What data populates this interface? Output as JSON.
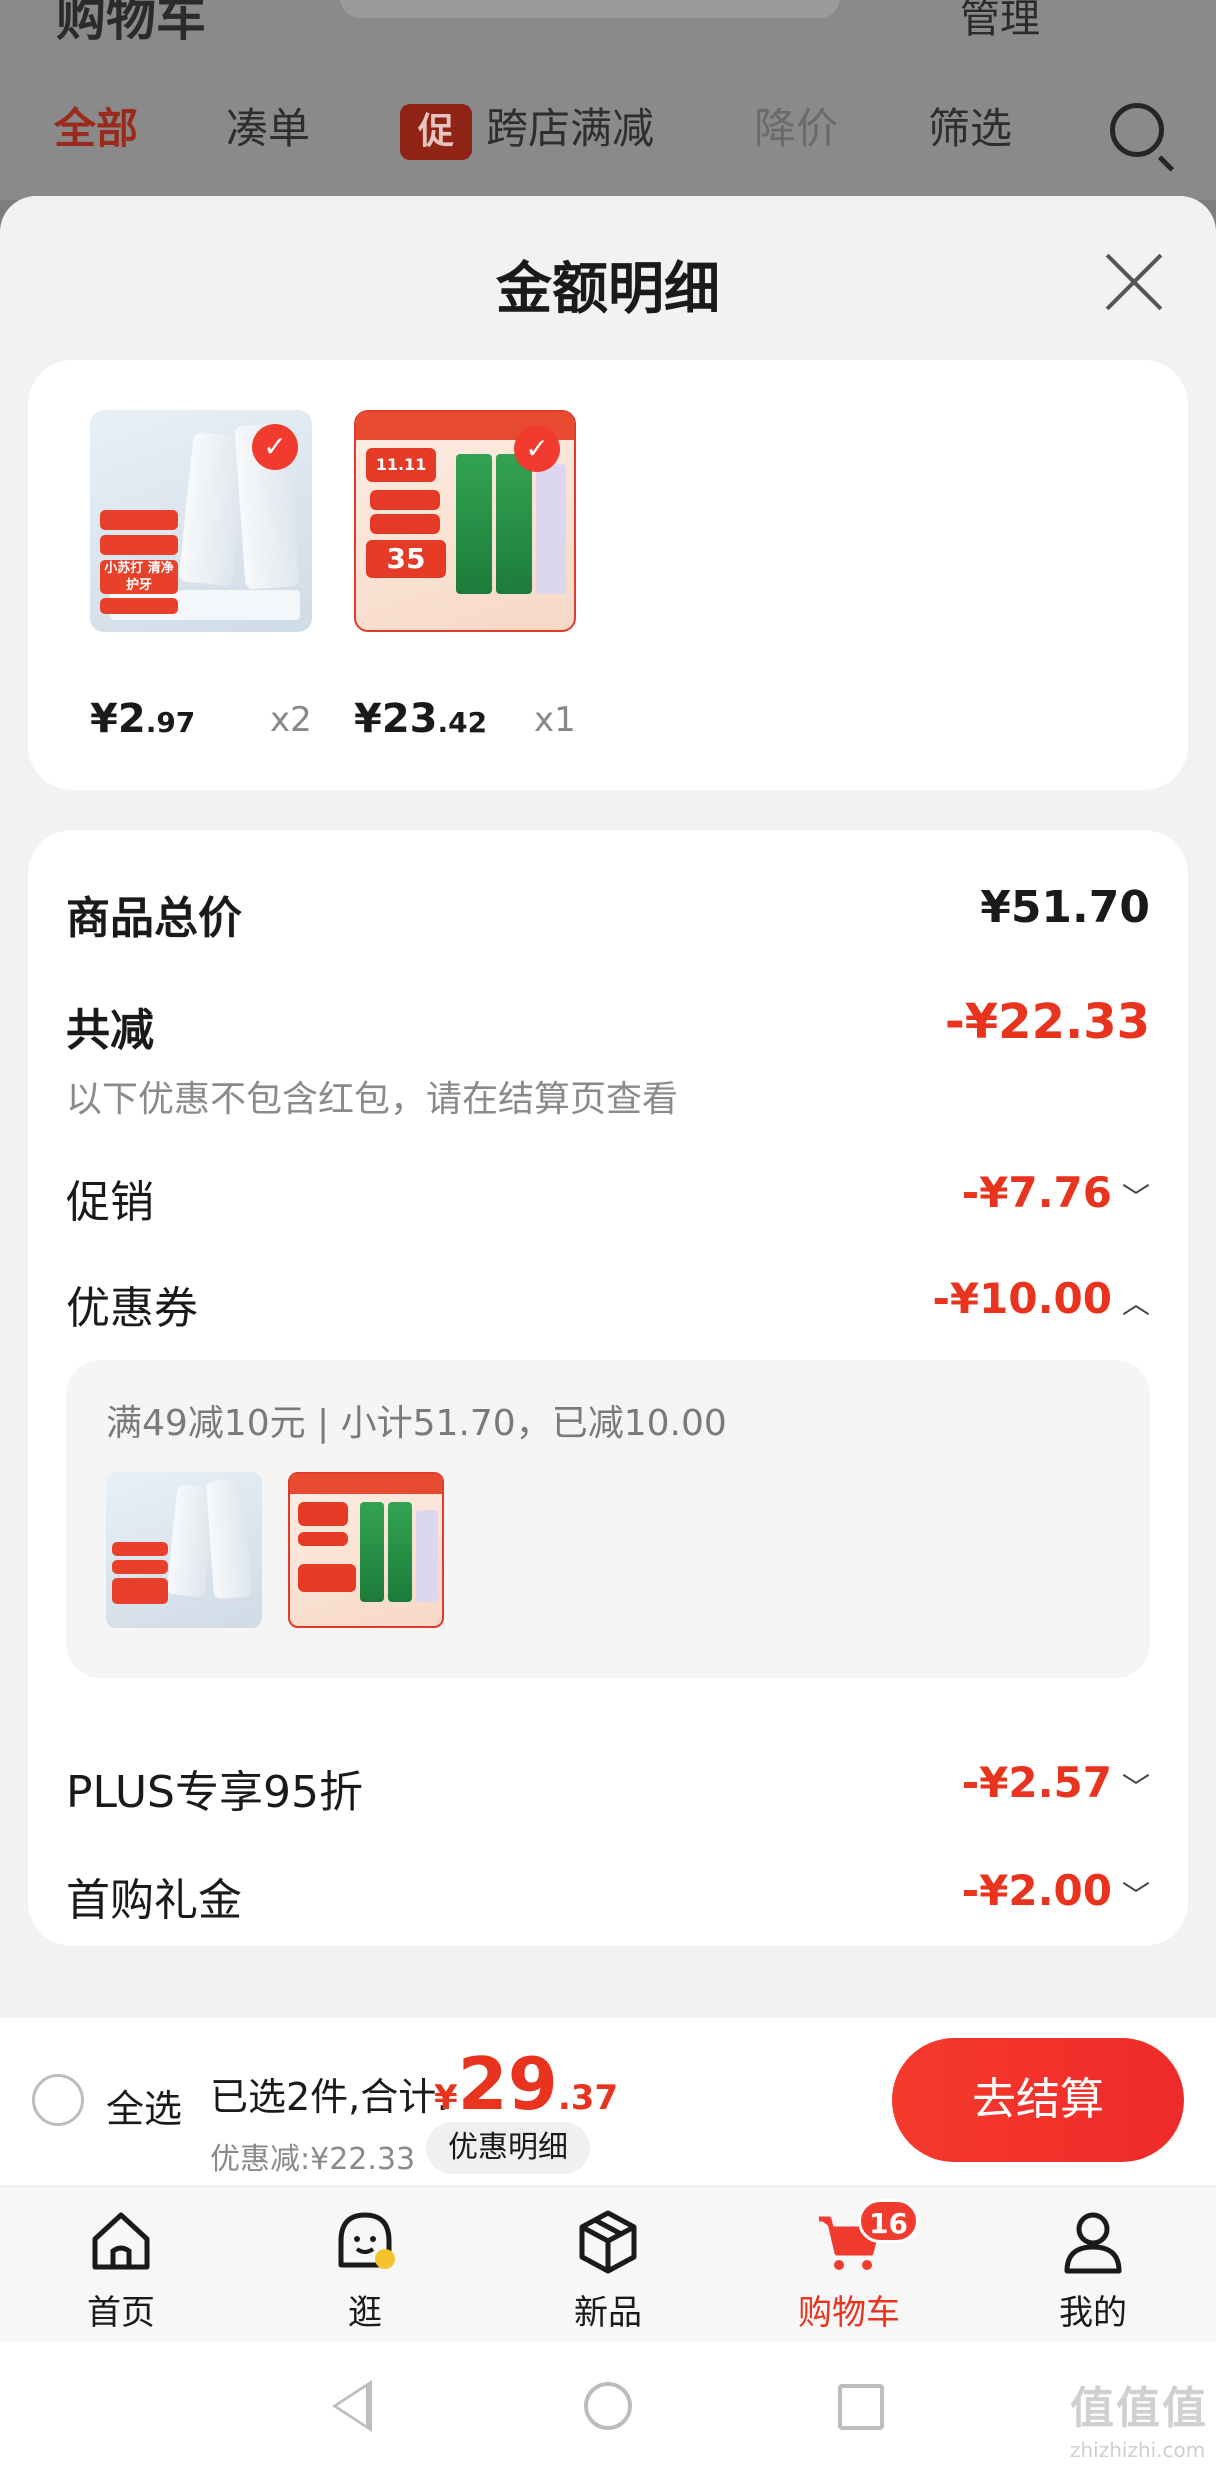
{
  "background_page": {
    "title": "购物车",
    "manage_label": "管理",
    "tabs": [
      "全部",
      "凑单",
      "跨店满减",
      "降价",
      "筛选"
    ],
    "promo_badge": "促"
  },
  "modal": {
    "title": "金额明细",
    "products": [
      {
        "price_symbol": "¥",
        "price_int": "2",
        "price_dec": ".97",
        "qty": "x2",
        "tag": "小苏打 清净护牙"
      },
      {
        "price_symbol": "¥",
        "price_int": "23",
        "price_dec": ".42",
        "qty": "x1",
        "tag": "35"
      }
    ],
    "total_label": "商品总价",
    "total_value": "¥51.70",
    "reduce_label": "共减",
    "reduce_value": "-¥22.33",
    "reduce_hint": "以下优惠不包含红包，请在结算页查看",
    "rows": [
      {
        "label": "促销",
        "value": "-¥7.76",
        "chevron": "﹀"
      },
      {
        "label": "优惠券",
        "value": "-¥10.00",
        "chevron": "︿"
      },
      {
        "label": "PLUS专享95折",
        "value": "-¥2.57",
        "chevron": "﹀"
      },
      {
        "label": "首购礼金",
        "value": "-¥2.00",
        "chevron": "﹀"
      }
    ],
    "coupon_detail": "满49减10元 | 小计51.70，已减10.00"
  },
  "checkout": {
    "select_all": "全选",
    "selected_text": "已选2件,合计:",
    "total_symbol": "¥",
    "total_int": "29",
    "total_dec": ".37",
    "discount_text": "优惠减:¥22.33",
    "detail_pill": "优惠明细",
    "button": "去结算"
  },
  "tabbar": {
    "items": [
      "首页",
      "逛",
      "新品",
      "购物车",
      "我的"
    ],
    "cart_badge": "16"
  },
  "watermark": {
    "text": "值值值",
    "sub": "zhizhizhi.com"
  },
  "colors": {
    "accent": "#e8341f",
    "button": "#f23b2f"
  }
}
